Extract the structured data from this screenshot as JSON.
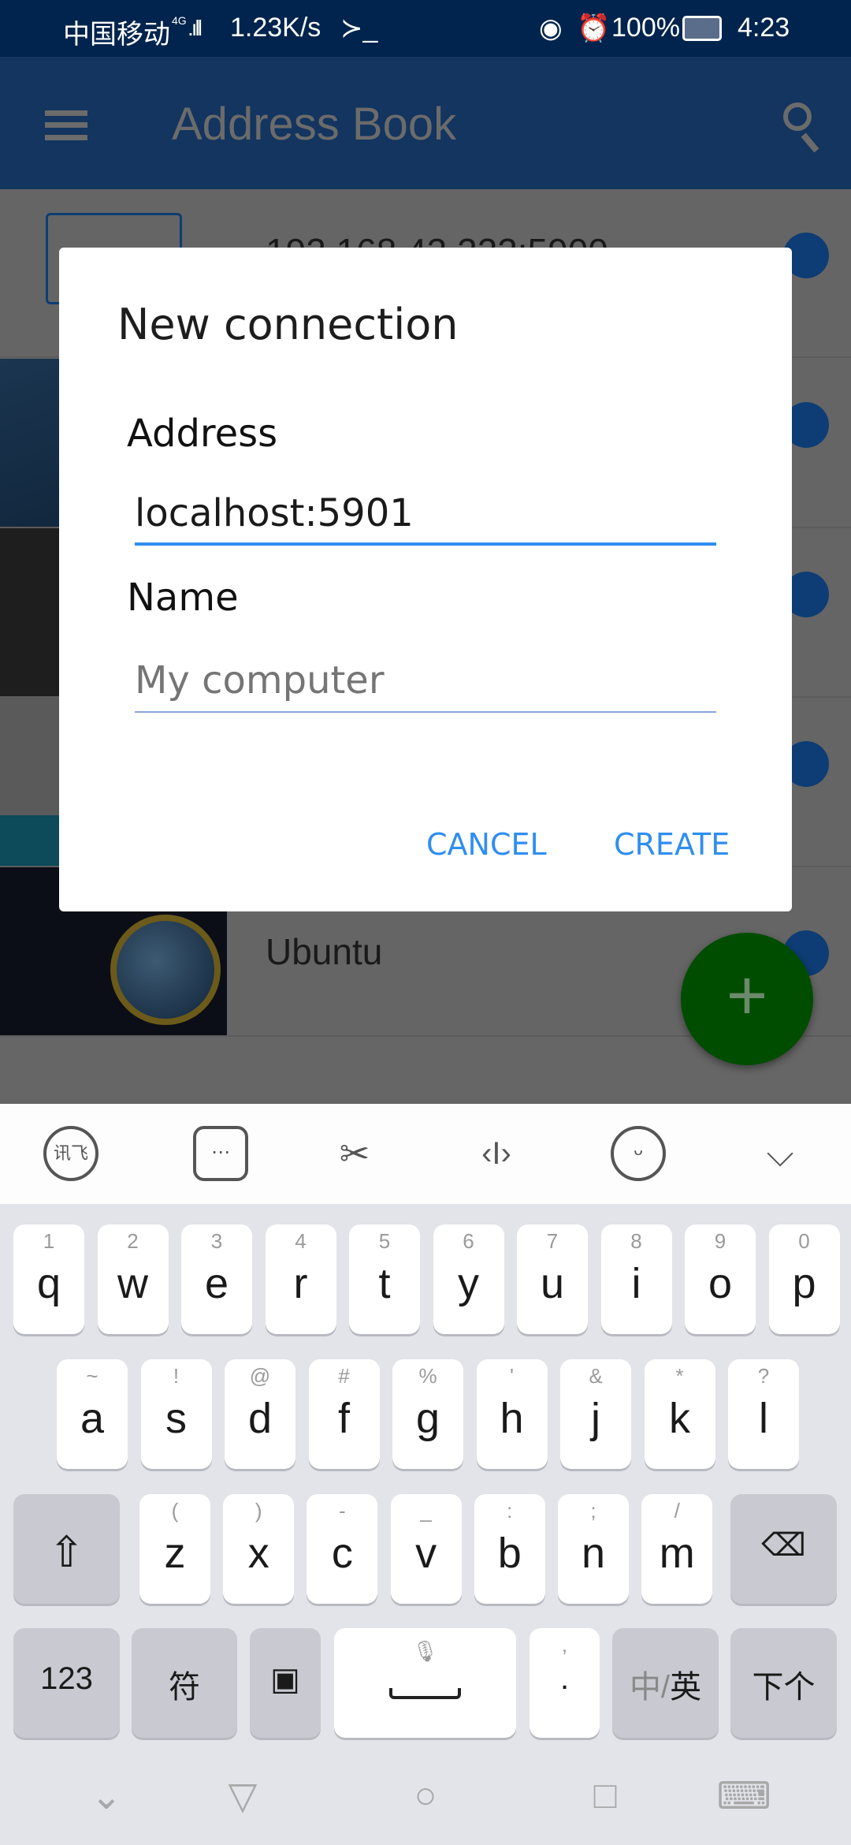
{
  "status_bar": {
    "carrier": "中国移动",
    "network": "4G",
    "speed": "1.23K/s",
    "terminal": "≻_",
    "battery": "100%",
    "time": "4:23"
  },
  "app_bar": {
    "title": "Address Book",
    "menu_icon": "hamburger-icon",
    "search_icon": "search-icon",
    "background": "#13355f"
  },
  "list": {
    "rows": [
      {
        "name": "192.168.43.222:5900"
      },
      {
        "name": ""
      },
      {
        "name": ""
      },
      {
        "name": ""
      },
      {
        "name": "Ubuntu"
      }
    ]
  },
  "fab": {
    "label": "+",
    "color": "#008000"
  },
  "dialog": {
    "title": "New connection",
    "address_label": "Address",
    "address_value": "localhost:5901",
    "name_label": "Name",
    "name_placeholder": "My computer",
    "cancel": "CANCEL",
    "create": "CREATE",
    "accent": "#2f8ef0"
  },
  "keyboard": {
    "toolbar": [
      "ifly-icon",
      "keyboard-layout-icon",
      "scissors-icon",
      "cursor-icon",
      "emoji-icon",
      "collapse-icon"
    ],
    "row1": [
      [
        "1",
        "q"
      ],
      [
        "2",
        "w"
      ],
      [
        "3",
        "e"
      ],
      [
        "4",
        "r"
      ],
      [
        "5",
        "t"
      ],
      [
        "6",
        "y"
      ],
      [
        "7",
        "u"
      ],
      [
        "8",
        "i"
      ],
      [
        "9",
        "o"
      ],
      [
        "0",
        "p"
      ]
    ],
    "row2": [
      [
        "~",
        "a"
      ],
      [
        "!",
        "s"
      ],
      [
        "@",
        "d"
      ],
      [
        "#",
        "f"
      ],
      [
        "%",
        "g"
      ],
      [
        "'",
        "h"
      ],
      [
        "&",
        "j"
      ],
      [
        "*",
        "k"
      ],
      [
        "?",
        "l"
      ]
    ],
    "row3": [
      [
        "(",
        "z"
      ],
      [
        ")",
        "x"
      ],
      [
        "-",
        "c"
      ],
      [
        "_",
        "v"
      ],
      [
        ":",
        "b"
      ],
      [
        ";",
        "n"
      ],
      [
        "/",
        "m"
      ]
    ],
    "num": "123",
    "sym": "符",
    "comma": ",",
    "period": ".",
    "lang_zh": "中/",
    "lang_en": "英",
    "next": "下个"
  },
  "nav_bar": [
    "hide-keyboard-icon",
    "back-icon",
    "home-icon",
    "recents-icon",
    "keyboard-icon"
  ]
}
